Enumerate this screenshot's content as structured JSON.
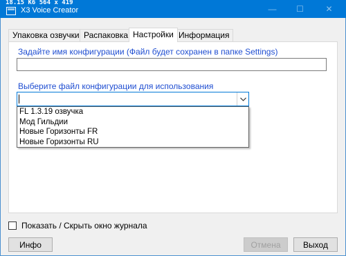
{
  "overlay": {
    "text": "18.15 K6 564 x 419"
  },
  "window": {
    "title": "X3 Voice Creator",
    "minimize_symbol": "—",
    "maximize_symbol": "☐",
    "close_symbol": "✕"
  },
  "tabs": [
    {
      "label": "Упаковка озвучки",
      "active": false
    },
    {
      "label": "Распаковка",
      "active": false
    },
    {
      "label": "Настройки",
      "active": true
    },
    {
      "label": "Информация",
      "active": false
    }
  ],
  "settings": {
    "config_name_label": "Задайте имя конфигурации (Файл будет сохранен в папке Settings)",
    "config_name_value": "",
    "config_file_label": "Выберите файл конфигурации для использования",
    "config_file_value": "",
    "config_file_options": [
      "FL 1.3.19 озвучка",
      "Мод Гильдии",
      "Новые Горизонты FR",
      "Новые Горизонты RU"
    ]
  },
  "log_toggle": {
    "label": "Показать / Скрыть окно журнала",
    "checked": false
  },
  "buttons": {
    "info": "Инфо",
    "cancel": "Отмена",
    "exit": "Выход"
  },
  "colors": {
    "titlebar": "#0078d7",
    "label_blue": "#1e4dd1",
    "focus_border": "#0078d7"
  },
  "icons": {
    "app": "app-icon",
    "dropdown_arrow": "chevron-down-icon"
  }
}
